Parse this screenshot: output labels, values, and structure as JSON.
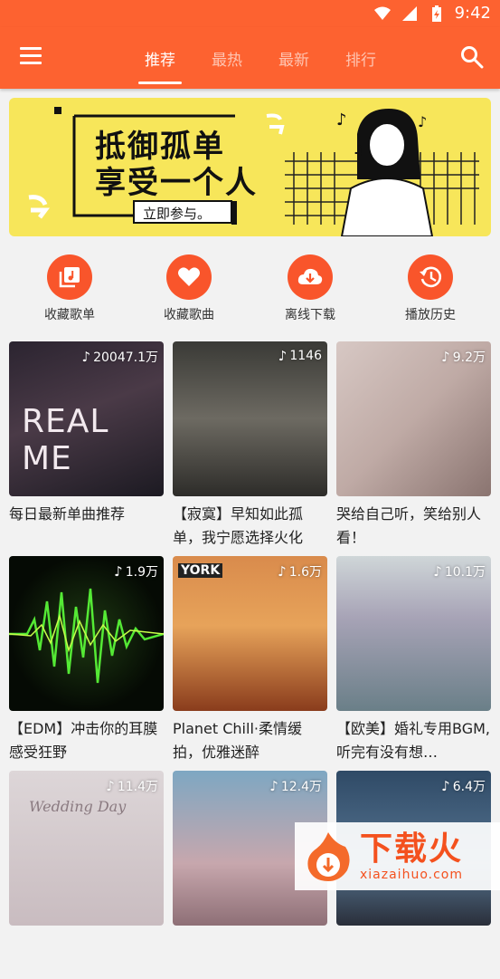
{
  "status": {
    "time": "9:42"
  },
  "tabs": [
    "推荐",
    "最热",
    "最新",
    "排行"
  ],
  "banner": {
    "line1": "抵御孤单",
    "line2": "享受一个人",
    "button": "立即参与。"
  },
  "quick_actions": [
    "收藏歌单",
    "收藏歌曲",
    "离线下载",
    "播放历史"
  ],
  "playlists": [
    {
      "count": "20047.1万",
      "title": "每日最新单曲推荐",
      "cover_text": "REAL ME"
    },
    {
      "count": "1146",
      "title": "【寂寞】早知如此孤单，我宁愿选择火化"
    },
    {
      "count": "9.2万",
      "title": "哭给自己听，笑给别人看！"
    },
    {
      "count": "1.9万",
      "title": "【EDM】冲击你的耳膜 感受狂野"
    },
    {
      "count": "1.6万",
      "title": "Planet Chill·柔情缓拍，优雅迷醉",
      "cover_text": "YORK"
    },
    {
      "count": "10.1万",
      "title": "【欧美】婚礼专用BGM,听完有没有想…"
    },
    {
      "count": "11.4万",
      "title": "",
      "cover_text": "Wedding Day"
    },
    {
      "count": "12.4万",
      "title": ""
    },
    {
      "count": "6.4万",
      "title": ""
    }
  ],
  "watermark": {
    "brand": "下载火",
    "url": "xiazaihuo.com"
  },
  "colors": {
    "primary": "#fd6230",
    "accent": "#f9552b",
    "banner": "#f7e65a"
  }
}
